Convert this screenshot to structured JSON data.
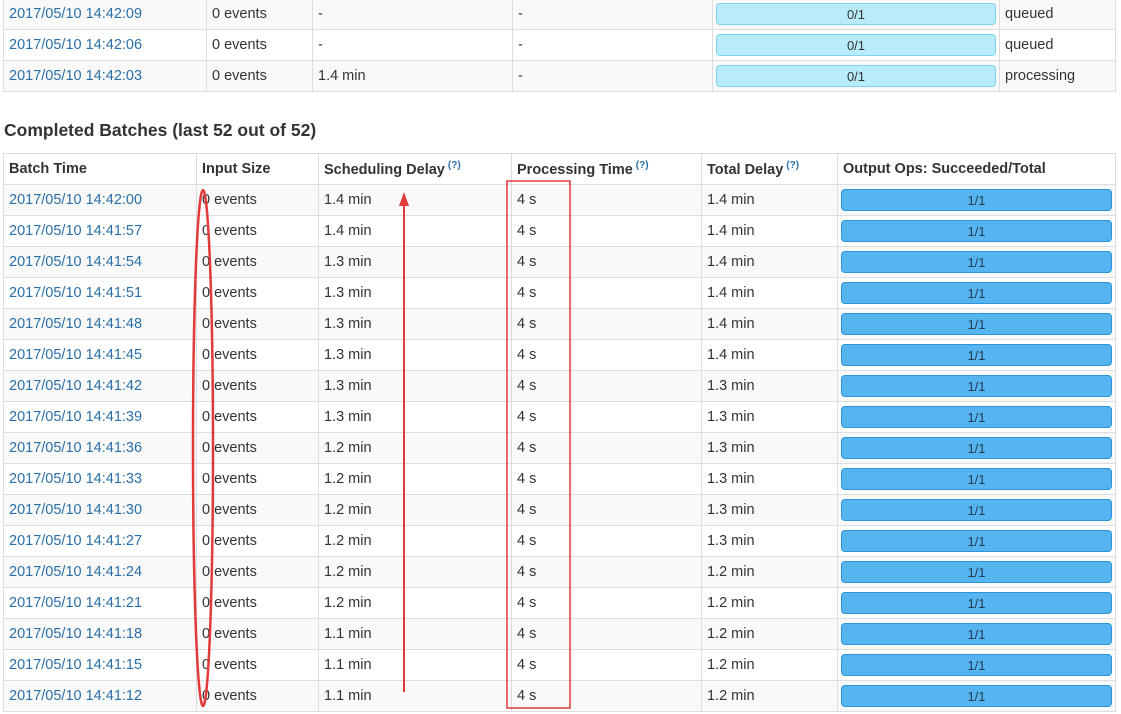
{
  "active_batches": [
    {
      "batch_time": "2017/05/10 14:42:09",
      "input_size": "0 events",
      "scheduling_delay": "-",
      "processing_time": "-",
      "output_ops": "0/1",
      "status": "queued"
    },
    {
      "batch_time": "2017/05/10 14:42:06",
      "input_size": "0 events",
      "scheduling_delay": "-",
      "processing_time": "-",
      "output_ops": "0/1",
      "status": "queued"
    },
    {
      "batch_time": "2017/05/10 14:42:03",
      "input_size": "0 events",
      "scheduling_delay": "1.4 min",
      "processing_time": "-",
      "output_ops": "0/1",
      "status": "processing"
    }
  ],
  "completed": {
    "title": "Completed Batches (last 52 out of 52)",
    "help_mark": "(?)",
    "headers": {
      "batch_time": "Batch Time",
      "input_size": "Input Size",
      "scheduling_delay": "Scheduling Delay",
      "processing_time": "Processing Time",
      "total_delay": "Total Delay",
      "output_ops": "Output Ops: Succeeded/Total"
    },
    "rows": [
      {
        "batch_time": "2017/05/10 14:42:00",
        "input_size": "0 events",
        "scheduling_delay": "1.4 min",
        "processing_time": "4 s",
        "total_delay": "1.4 min",
        "output_ops": "1/1"
      },
      {
        "batch_time": "2017/05/10 14:41:57",
        "input_size": "0 events",
        "scheduling_delay": "1.4 min",
        "processing_time": "4 s",
        "total_delay": "1.4 min",
        "output_ops": "1/1"
      },
      {
        "batch_time": "2017/05/10 14:41:54",
        "input_size": "0 events",
        "scheduling_delay": "1.3 min",
        "processing_time": "4 s",
        "total_delay": "1.4 min",
        "output_ops": "1/1"
      },
      {
        "batch_time": "2017/05/10 14:41:51",
        "input_size": "0 events",
        "scheduling_delay": "1.3 min",
        "processing_time": "4 s",
        "total_delay": "1.4 min",
        "output_ops": "1/1"
      },
      {
        "batch_time": "2017/05/10 14:41:48",
        "input_size": "0 events",
        "scheduling_delay": "1.3 min",
        "processing_time": "4 s",
        "total_delay": "1.4 min",
        "output_ops": "1/1"
      },
      {
        "batch_time": "2017/05/10 14:41:45",
        "input_size": "0 events",
        "scheduling_delay": "1.3 min",
        "processing_time": "4 s",
        "total_delay": "1.4 min",
        "output_ops": "1/1"
      },
      {
        "batch_time": "2017/05/10 14:41:42",
        "input_size": "0 events",
        "scheduling_delay": "1.3 min",
        "processing_time": "4 s",
        "total_delay": "1.3 min",
        "output_ops": "1/1"
      },
      {
        "batch_time": "2017/05/10 14:41:39",
        "input_size": "0 events",
        "scheduling_delay": "1.3 min",
        "processing_time": "4 s",
        "total_delay": "1.3 min",
        "output_ops": "1/1"
      },
      {
        "batch_time": "2017/05/10 14:41:36",
        "input_size": "0 events",
        "scheduling_delay": "1.2 min",
        "processing_time": "4 s",
        "total_delay": "1.3 min",
        "output_ops": "1/1"
      },
      {
        "batch_time": "2017/05/10 14:41:33",
        "input_size": "0 events",
        "scheduling_delay": "1.2 min",
        "processing_time": "4 s",
        "total_delay": "1.3 min",
        "output_ops": "1/1"
      },
      {
        "batch_time": "2017/05/10 14:41:30",
        "input_size": "0 events",
        "scheduling_delay": "1.2 min",
        "processing_time": "4 s",
        "total_delay": "1.3 min",
        "output_ops": "1/1"
      },
      {
        "batch_time": "2017/05/10 14:41:27",
        "input_size": "0 events",
        "scheduling_delay": "1.2 min",
        "processing_time": "4 s",
        "total_delay": "1.3 min",
        "output_ops": "1/1"
      },
      {
        "batch_time": "2017/05/10 14:41:24",
        "input_size": "0 events",
        "scheduling_delay": "1.2 min",
        "processing_time": "4 s",
        "total_delay": "1.2 min",
        "output_ops": "1/1"
      },
      {
        "batch_time": "2017/05/10 14:41:21",
        "input_size": "0 events",
        "scheduling_delay": "1.2 min",
        "processing_time": "4 s",
        "total_delay": "1.2 min",
        "output_ops": "1/1"
      },
      {
        "batch_time": "2017/05/10 14:41:18",
        "input_size": "0 events",
        "scheduling_delay": "1.1 min",
        "processing_time": "4 s",
        "total_delay": "1.2 min",
        "output_ops": "1/1"
      },
      {
        "batch_time": "2017/05/10 14:41:15",
        "input_size": "0 events",
        "scheduling_delay": "1.1 min",
        "processing_time": "4 s",
        "total_delay": "1.2 min",
        "output_ops": "1/1"
      },
      {
        "batch_time": "2017/05/10 14:41:12",
        "input_size": "0 events",
        "scheduling_delay": "1.1 min",
        "processing_time": "4 s",
        "total_delay": "1.2 min",
        "output_ops": "1/1"
      }
    ]
  },
  "colors": {
    "link": "#2a6fa8",
    "queued_bar": "#b9ecfb",
    "succeeded_bar": "#56b4f0",
    "annotation": "#e03a3a"
  },
  "progress": {
    "active_succeeded_fraction": 0,
    "completed_succeeded_fraction": 1
  }
}
